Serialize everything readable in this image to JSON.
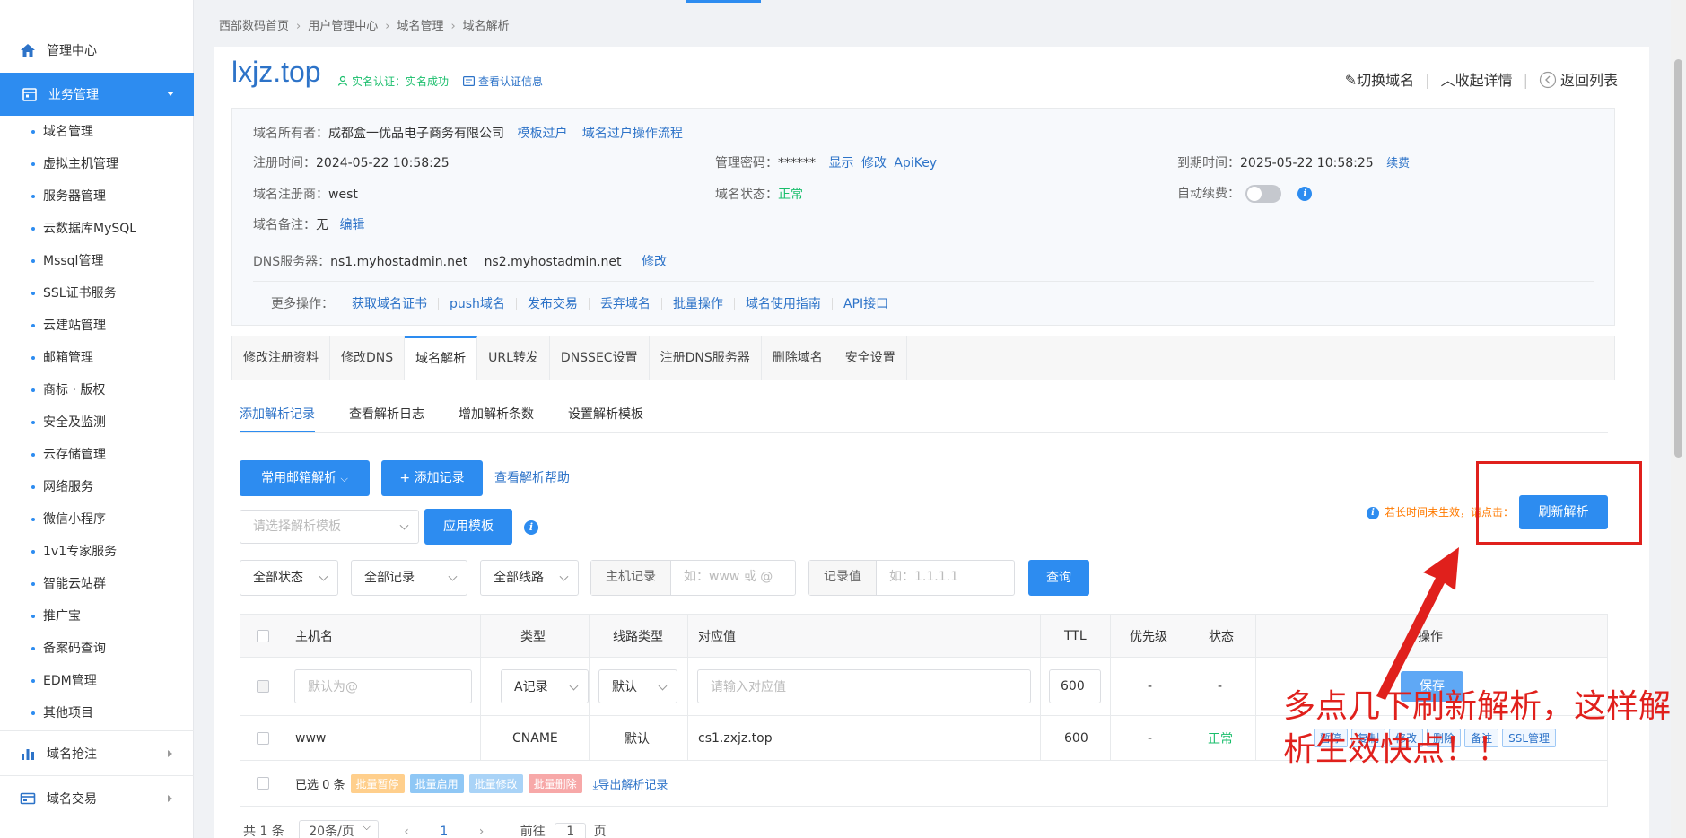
{
  "sidebar": {
    "home": "管理中心",
    "business": "业务管理",
    "items": [
      "域名管理",
      "虚拟主机管理",
      "服务器管理",
      "云数据库MySQL",
      "Mssql管理",
      "SSL证书服务",
      "云建站管理",
      "邮箱管理",
      "商标 · 版权",
      "安全及监测",
      "云存储管理",
      "网络服务",
      "微信小程序",
      "1v1专家服务",
      "智能云站群",
      "推广宝",
      "备案码查询",
      "EDM管理",
      "其他项目"
    ],
    "group1": "域名抢注",
    "group2": "域名交易"
  },
  "breadcrumb": [
    "西部数码首页",
    "用户管理中心",
    "域名管理",
    "域名解析"
  ],
  "header": {
    "domain": "lxjz.top",
    "verify": "实名认证：实名成功",
    "verify_info": "查看认证信息",
    "switch": "切换域名",
    "collapse": "收起详情",
    "back": "返回列表"
  },
  "info": {
    "owner_label": "域名所有者：",
    "owner": "成都盒一优品电子商务有限公司",
    "transfer_template": "模板过户",
    "transfer_flow": "域名过户操作流程",
    "reg_time_label": "注册时间：",
    "reg_time": "2024-05-22 10:58:25",
    "pwd_label": "管理密码：",
    "pwd": "******",
    "pwd_show": "显示",
    "pwd_edit": "修改",
    "apikey": "ApiKey",
    "expire_label": "到期时间：",
    "expire": "2025-05-22 10:58:25",
    "renew": "续费",
    "registrar_label": "域名注册商：",
    "registrar": "west",
    "status_label": "域名状态：",
    "status": "正常",
    "auto_renew_label": "自动续费：",
    "remark_label": "域名备注：",
    "remark": "无",
    "remark_edit": "编辑",
    "dns_label": "DNS服务器：",
    "dns1": "ns1.myhostadmin.net",
    "dns2": "ns2.myhostadmin.net",
    "dns_edit": "修改",
    "more_label": "更多操作：",
    "more_ops": [
      "获取域名证书",
      "push域名",
      "发布交易",
      "丢弃域名",
      "批量操作",
      "域名使用指南",
      "API接口"
    ]
  },
  "tabs": [
    "修改注册资料",
    "修改DNS",
    "域名解析",
    "URL转发",
    "DNSSEC设置",
    "注册DNS服务器",
    "删除域名",
    "安全设置"
  ],
  "subtabs": [
    "添加解析记录",
    "查看解析日志",
    "增加解析条数",
    "设置解析模板"
  ],
  "toolbar": {
    "mail_btn": "常用邮箱解析",
    "add_btn": "+ 添加记录",
    "help": "查看解析帮助",
    "template_placeholder": "请选择解析模板",
    "apply_btn": "应用模板",
    "refresh_hint": "若长时间未生效，请点击：",
    "refresh_btn": "刷新解析"
  },
  "filters": {
    "status": "全部状态",
    "record": "全部记录",
    "line": "全部线路",
    "host_label": "主机记录",
    "host_ph": "如：www 或 @",
    "value_label": "记录值",
    "value_ph": "如：1.1.1.1",
    "query_btn": "查询"
  },
  "table": {
    "headers": [
      "主机名",
      "类型",
      "线路类型",
      "对应值",
      "TTL",
      "优先级",
      "状态",
      "操作"
    ],
    "new_row": {
      "host_ph": "默认为@",
      "type": "A记录",
      "line": "默认",
      "value_ph": "请输入对应值",
      "ttl": "600",
      "priority": "-",
      "status": "-",
      "save": "保存"
    },
    "rows": [
      {
        "host": "www",
        "type": "CNAME",
        "line": "默认",
        "value": "cs1.zxjz.top",
        "ttl": "600",
        "priority": "-",
        "status": "正常",
        "ops": [
          "暂停",
          "复制",
          "修改",
          "删除",
          "备注",
          "SSL管理"
        ]
      }
    ],
    "footer": {
      "selected": "已选 0 条",
      "bulk": [
        "批量暂停",
        "批量启用",
        "批量修改",
        "批量删除"
      ],
      "export": "导出解析记录"
    }
  },
  "pagination": {
    "total": "共 1 条",
    "per_page": "20条/页",
    "current": "1",
    "goto_label": "前往",
    "goto_value": "1",
    "page_label": "页"
  },
  "annotation": "多点几下刷新解析，这样解析生效快点！！",
  "colors": {
    "primary": "#2d8cf0",
    "link": "#2d73c8",
    "ok": "#19be6b",
    "annot": "#e0201c"
  }
}
